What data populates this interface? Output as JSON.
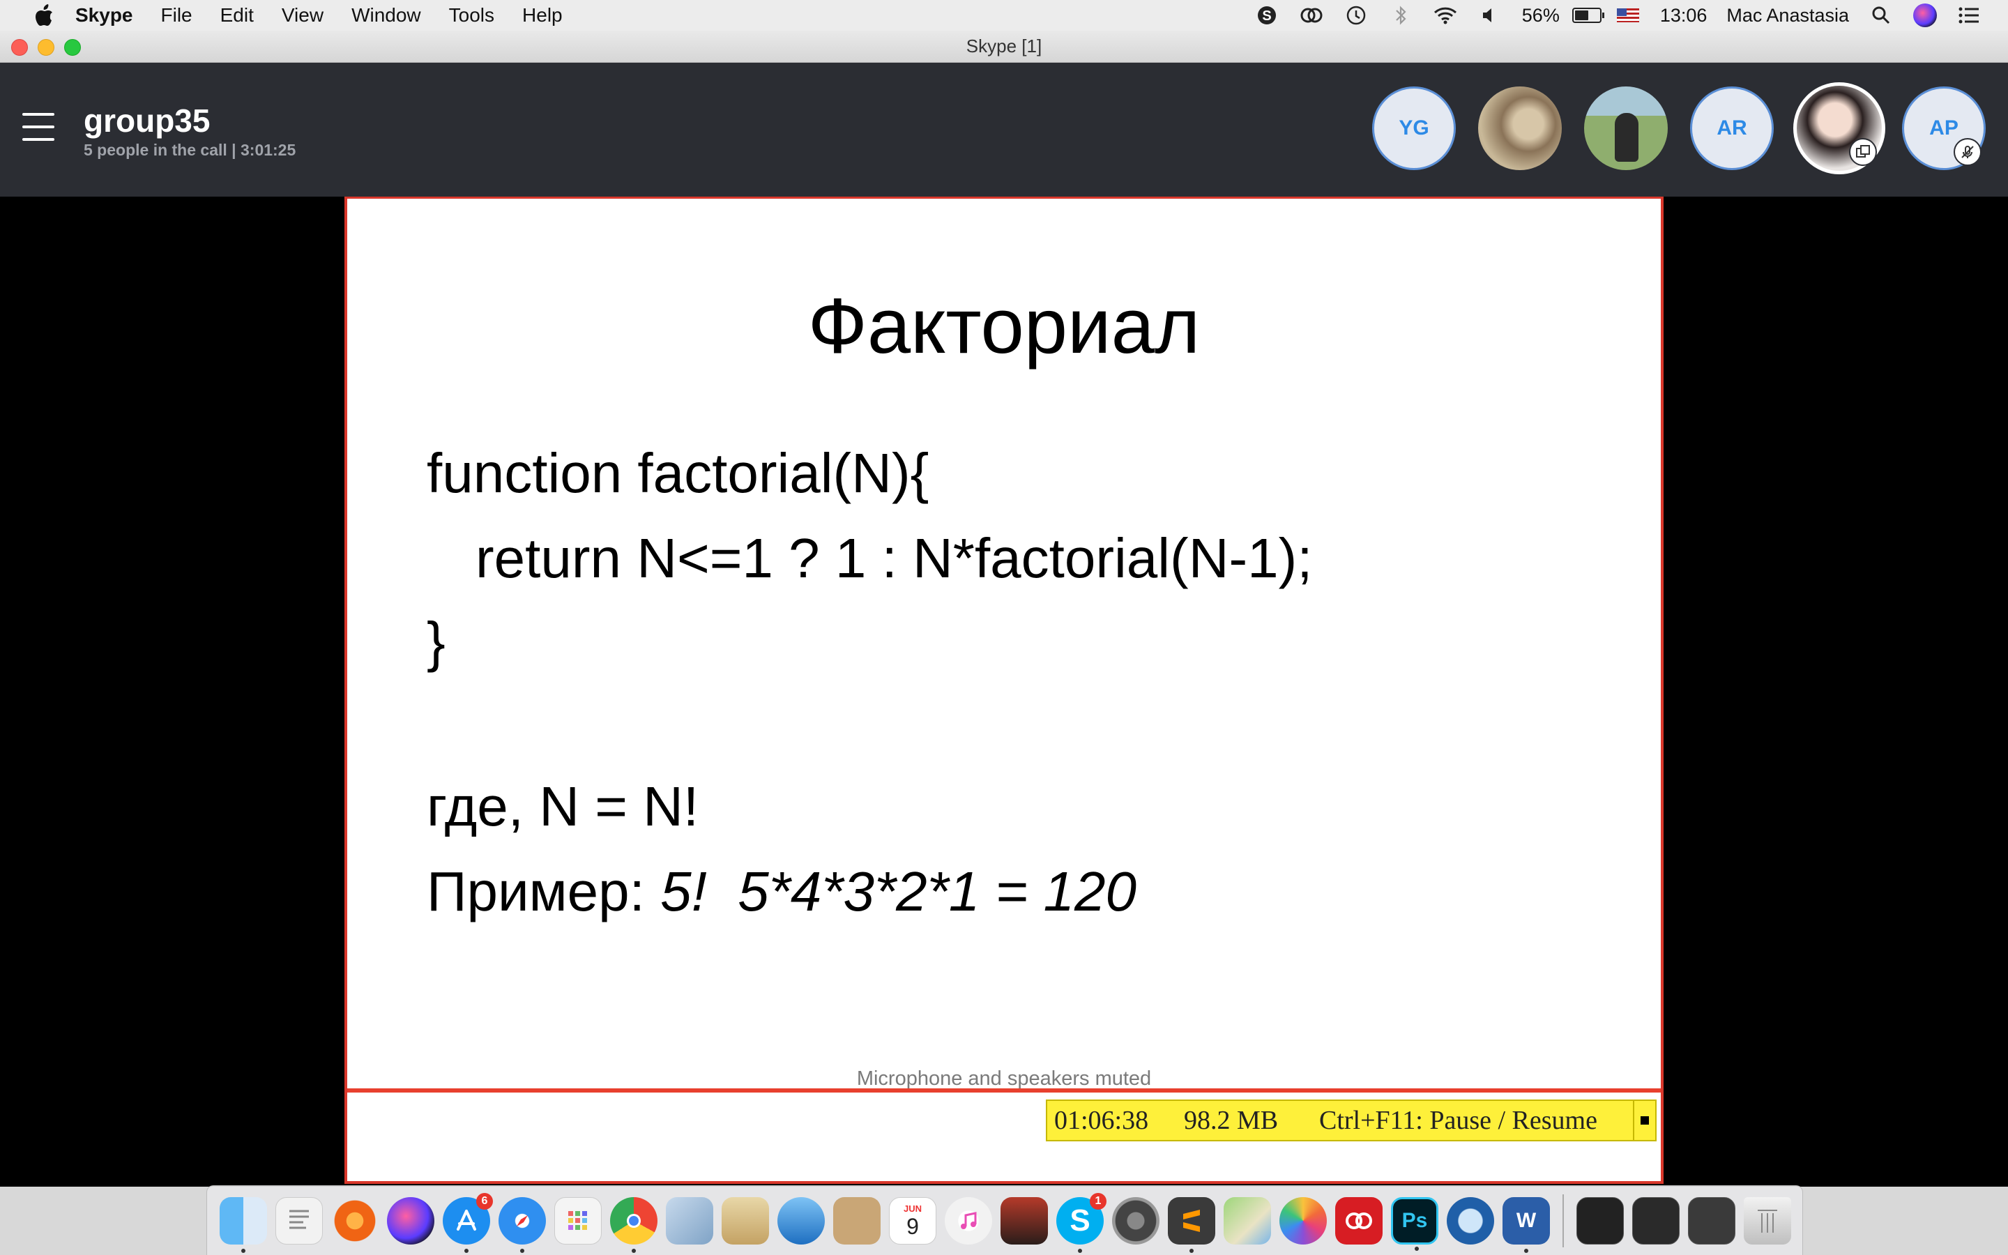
{
  "menubar": {
    "apple_icon": "apple-icon",
    "app_name": "Skype",
    "menus": [
      "File",
      "Edit",
      "View",
      "Window",
      "Tools",
      "Help"
    ],
    "battery_percent": "56%",
    "battery_level": 0.56,
    "clock": "13:06",
    "user": "Mac Anastasia"
  },
  "window": {
    "title": "Skype [1]"
  },
  "call": {
    "group_name": "group35",
    "status": "5 people in the call | 3:01:25",
    "participants": [
      {
        "initials": "YG"
      },
      {
        "initials": ""
      },
      {
        "initials": ""
      },
      {
        "initials": "AR"
      },
      {
        "initials": ""
      },
      {
        "initials": "AP"
      }
    ]
  },
  "slide": {
    "title": "Факториал",
    "code_line1": "function factorial(N){",
    "code_line2": "return N<=1 ? 1 : N*factorial(N-1);",
    "code_line3": "}",
    "where_line": "где, N = N!",
    "example_label": "Пример: ",
    "example_value": "5!  5*4*3*2*1 = 120"
  },
  "status": {
    "muted_message": "Microphone and speakers muted"
  },
  "recorder": {
    "elapsed": "01:06:38",
    "size": "98.2 MB",
    "hotkey": "Ctrl+F11: Pause / Resume"
  },
  "dock": {
    "badges": {
      "app_store": "6",
      "skype": "1"
    },
    "calendar_month": "JUN",
    "calendar_day": "9",
    "photoshop_label": "Ps",
    "word_label": "W"
  },
  "colors": {
    "call_header_bg": "#2b2d33",
    "slide_border": "#d9372b",
    "recorder_bg": "#fef03a",
    "avatar_text": "#2d8ae6"
  }
}
